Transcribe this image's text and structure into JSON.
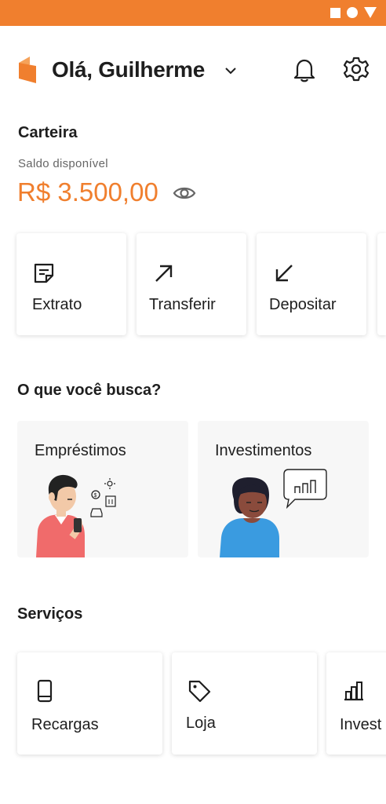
{
  "header": {
    "greeting": "Olá, Guilherme"
  },
  "wallet": {
    "title": "Carteira",
    "balance_label": "Saldo disponível",
    "balance_value": "R$ 3.500,00"
  },
  "quick_actions": [
    {
      "label": "Extrato",
      "icon": "statement-icon"
    },
    {
      "label": "Transferir",
      "icon": "arrow-up-right-icon"
    },
    {
      "label": "Depositar",
      "icon": "arrow-down-left-icon"
    }
  ],
  "search": {
    "title": "O que você busca?",
    "items": [
      {
        "label": "Empréstimos"
      },
      {
        "label": "Investimentos"
      }
    ]
  },
  "services": {
    "title": "Serviços",
    "items": [
      {
        "label": "Recargas",
        "icon": "phone-icon"
      },
      {
        "label": "Loja",
        "icon": "tag-icon"
      },
      {
        "label": "Invest",
        "icon": "bar-chart-icon"
      }
    ]
  },
  "colors": {
    "accent": "#f07f2e",
    "text": "#1e1e1e",
    "muted": "#666666",
    "card_bg": "#f7f7f7"
  }
}
